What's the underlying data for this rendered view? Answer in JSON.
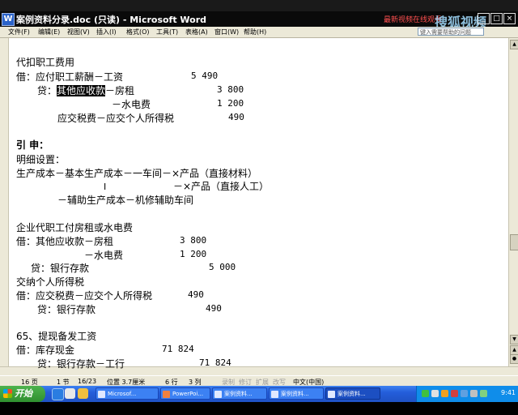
{
  "window": {
    "title": "案例资料分录.doc (只读) - Microsoft Word",
    "icon_letter": "W",
    "watermark": "搜狐视频",
    "red_tag": "最新视频在线观看",
    "buttons": {
      "minimize": "_",
      "maximize": "□",
      "close": "×"
    }
  },
  "menubar": {
    "items": [
      "文件(F)",
      "编辑(E)",
      "视图(V)",
      "插入(I)",
      "格式(O)",
      "工具(T)",
      "表格(A)",
      "窗口(W)",
      "帮助(H)"
    ],
    "help_placeholder": "键入需要帮助的问题"
  },
  "document": {
    "lines": [
      {
        "text": "代扣职工费用"
      },
      {
        "text": "借：应付职工薪酬－工资"
      },
      {
        "text_pre": "贷：",
        "text_sel": "其他应收款",
        "text_post": "－房租"
      },
      {
        "text": "－水电费"
      },
      {
        "text": "应交税费－应交个人所得税"
      },
      {
        "text": "引  申："
      },
      {
        "text": "明细设置："
      },
      {
        "text": "生产成本－基本生产成本－一车间－×产品（直接材料）"
      },
      {
        "text": "－×产品（直接人工）"
      },
      {
        "text": "－辅助生产成本－机修辅助车间"
      },
      {
        "text": "企业代职工付房租或水电费"
      },
      {
        "text": "借：其他应收款－房租"
      },
      {
        "text": "－水电费"
      },
      {
        "text": "贷：银行存款"
      },
      {
        "text": "交纳个人所得税"
      },
      {
        "text": "借：应交税费－应交个人所得税"
      },
      {
        "text": "贷：银行存款"
      },
      {
        "text": "65、提现备发工资"
      },
      {
        "text": "借：库存现金"
      },
      {
        "text": "贷：银行存款－工行"
      }
    ],
    "numbers": [
      "5 490",
      "3 800",
      "1 200",
      "490",
      "3 800",
      "1 200",
      "5 000",
      "490",
      "490",
      "71 824",
      "71 824"
    ],
    "cursor_glyph": "I"
  },
  "statusbar": {
    "page": "16 页",
    "section": "1 节",
    "page_of": "16/23",
    "position": "位置 3.7厘米",
    "line": "6 行",
    "column": "3 列",
    "rec": "录制",
    "trk": "修订",
    "ext": "扩展",
    "ovr": "改写",
    "language": "中文(中国)"
  },
  "taskbar": {
    "start_label": "开始",
    "tasks": [
      "Microsof...",
      "PowerPoi...",
      "案例资料...",
      "案例资料...",
      "案例资料..."
    ],
    "clock": "9:41"
  }
}
